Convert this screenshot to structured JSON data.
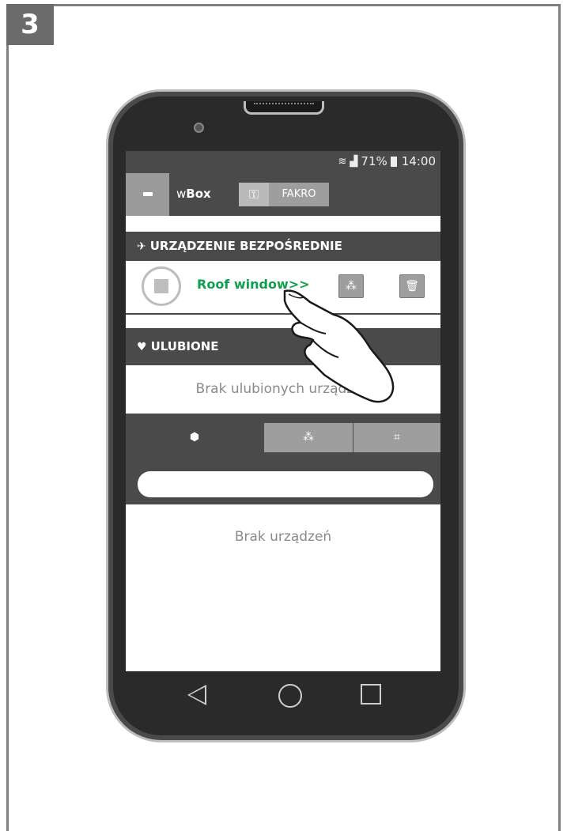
{
  "step_number": "3",
  "status": {
    "battery": "71%",
    "time": "14:00"
  },
  "appbar": {
    "title_prefix": "w",
    "title_bold": "Box",
    "account_button": "FAKRO"
  },
  "direct_section": {
    "heading": "URZĄDZENIE BEZPOŚREDNIE",
    "device_label": "Roof window>>"
  },
  "favorites_section": {
    "heading": "ULUBIONE",
    "empty_text": "Brak ulubionych urządzeń"
  },
  "devices": {
    "empty_text": "Brak urządzeń",
    "search_placeholder": ""
  },
  "icons": {
    "pin": "pin-icon",
    "heart": "heart-icon",
    "key": "key-icon",
    "tabs": [
      "single-device-icon",
      "device-group-icon",
      "scene-icon"
    ]
  },
  "colors": {
    "accent_green": "#0ea04e",
    "bar_dark": "#4a4a4a",
    "button_grey": "#9e9e9e"
  }
}
